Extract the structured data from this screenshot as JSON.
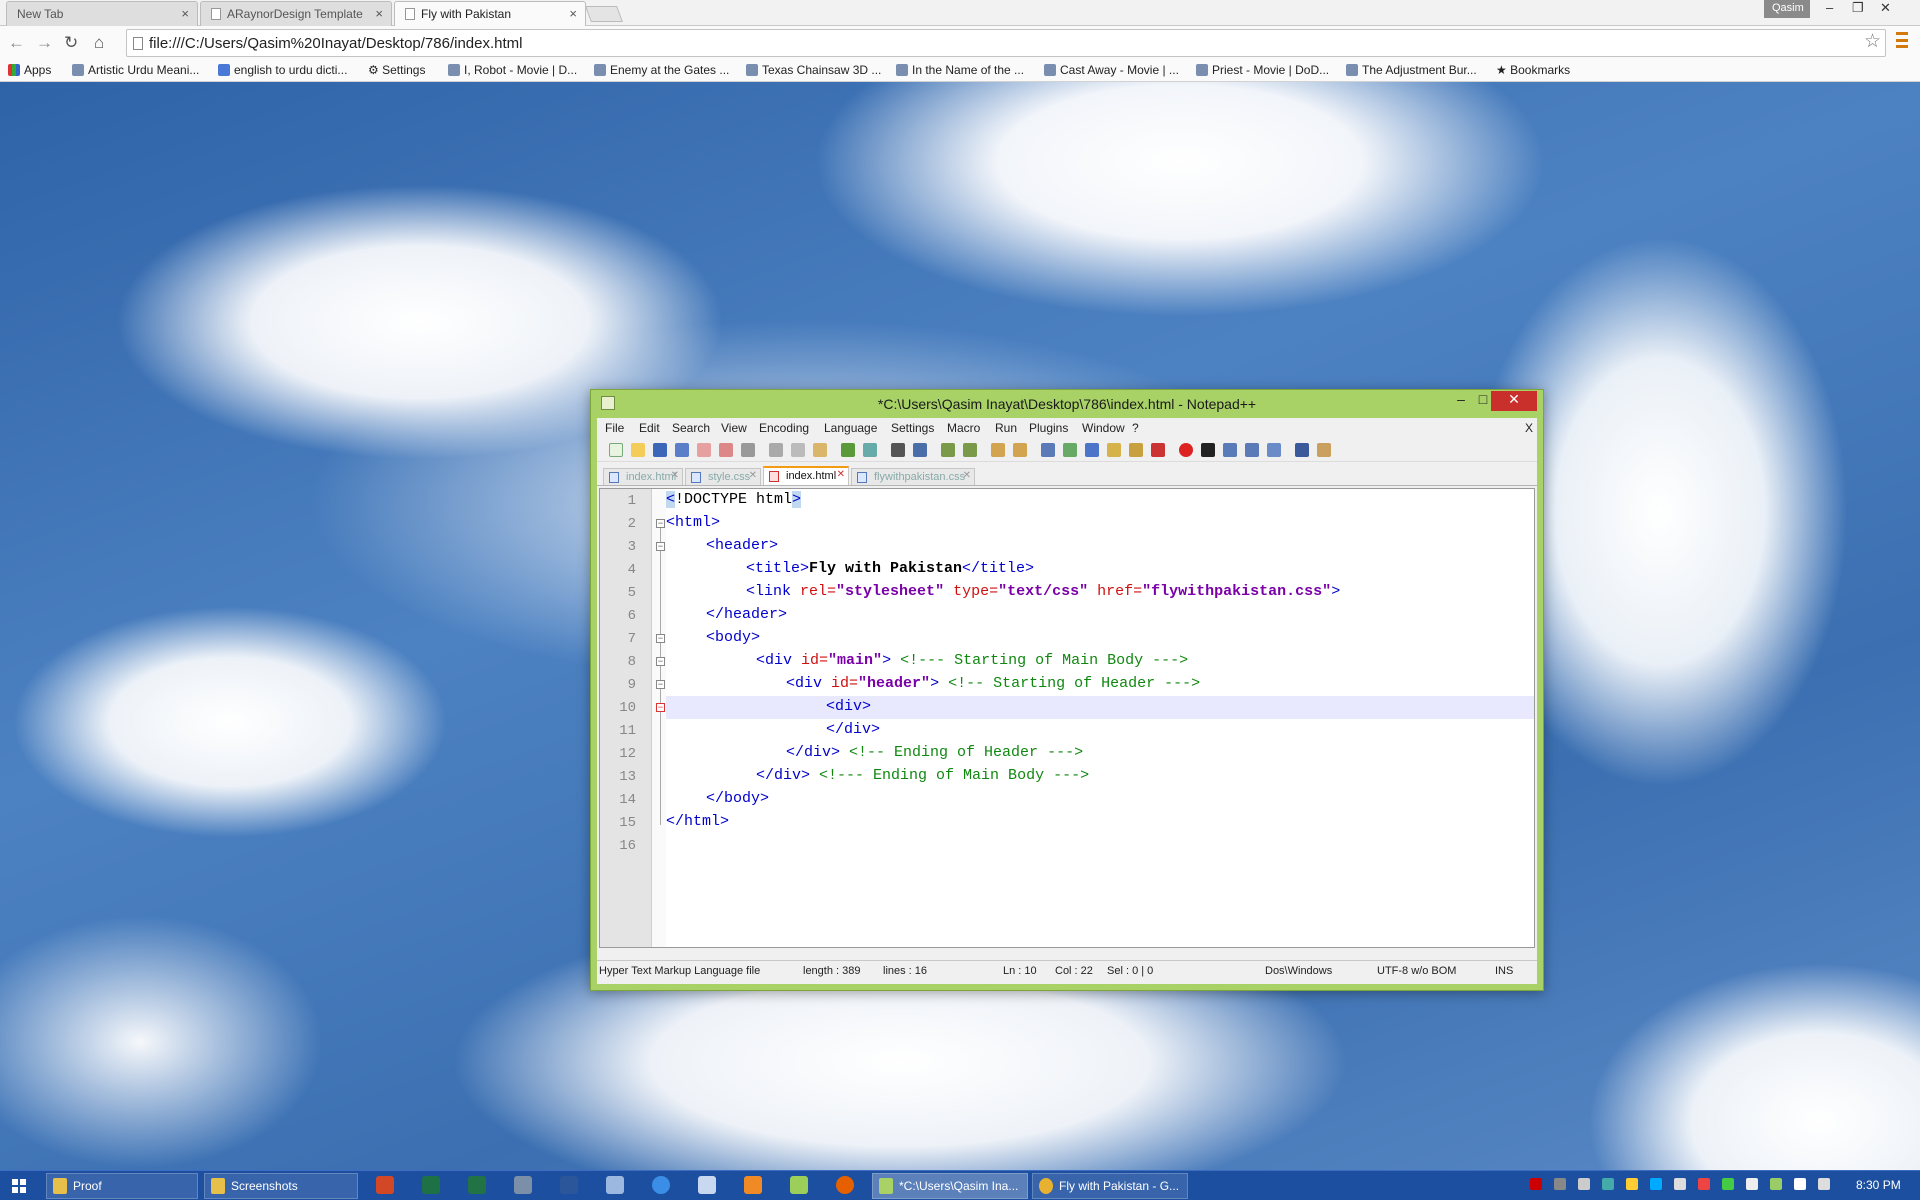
{
  "browser": {
    "tabs": [
      {
        "label": "New Tab"
      },
      {
        "label": "ARaynorDesign Template"
      },
      {
        "label": "Fly with Pakistan"
      }
    ],
    "user": "Qasim",
    "address": "file:///C:/Users/Qasim%20Inayat/Desktop/786/index.html",
    "bookmarks": [
      {
        "label": "Apps"
      },
      {
        "label": "Artistic Urdu Meani..."
      },
      {
        "label": "english to urdu dicti..."
      },
      {
        "label": "Settings"
      },
      {
        "label": "I, Robot - Movie | D..."
      },
      {
        "label": "Enemy at the Gates ..."
      },
      {
        "label": "Texas Chainsaw 3D ..."
      },
      {
        "label": "In the Name of the ..."
      },
      {
        "label": "Cast Away - Movie | ..."
      },
      {
        "label": "Priest - Movie | DoD..."
      },
      {
        "label": "The Adjustment Bur..."
      },
      {
        "label": "Bookmarks"
      }
    ]
  },
  "npp": {
    "title": "*C:\\Users\\Qasim Inayat\\Desktop\\786\\index.html - Notepad++",
    "menu": [
      "File",
      "Edit",
      "Search",
      "View",
      "Encoding",
      "Language",
      "Settings",
      "Macro",
      "Run",
      "Plugins",
      "Window",
      "?"
    ],
    "menu_close": "X",
    "doc_tabs": [
      {
        "label": "index.html"
      },
      {
        "label": "style.css"
      },
      {
        "label": "index.html"
      },
      {
        "label": "flywithpakistan.css"
      }
    ],
    "line_numbers": [
      "1",
      "2",
      "3",
      "4",
      "5",
      "6",
      "7",
      "8",
      "9",
      "10",
      "11",
      "12",
      "13",
      "14",
      "15",
      "16"
    ],
    "code": {
      "l1": {
        "a": "<",
        "b": "!DOCTYPE html",
        "c": ">"
      },
      "l2": "<html>",
      "l3": "<header>",
      "l4": {
        "open": "<title>",
        "text": "Fly with Pakistan",
        "close": "</title>"
      },
      "l5": {
        "tag": "<link",
        "a1": "rel=",
        "v1": "\"stylesheet\"",
        "a2": "type=",
        "v2": "\"text/css\"",
        "a3": "href=",
        "v3": "\"flywithpakistan.css\"",
        "end": ">"
      },
      "l6": "</header>",
      "l7": "<body>",
      "l8": {
        "tag": "<div",
        "attr": "id=",
        "val": "\"main\"",
        "end": ">",
        "comment": "<!--- Starting of Main Body --->"
      },
      "l9": {
        "tag": "<div",
        "attr": "id=",
        "val": "\"header\"",
        "end": ">",
        "comment": "<!-- Starting of Header --->"
      },
      "l10": "<div>",
      "l11": "</div>",
      "l12": {
        "tag": "</div>",
        "comment": "<!-- Ending of Header --->"
      },
      "l13": {
        "tag": "</div>",
        "comment": "<!--- Ending of Main Body --->"
      },
      "l14": "</body>",
      "l15": "</html>"
    },
    "status": {
      "type": "Hyper Text Markup Language file",
      "length": "length : 389",
      "lines": "lines : 16",
      "ln": "Ln : 10",
      "col": "Col : 22",
      "sel": "Sel : 0 | 0",
      "eol": "Dos\\Windows",
      "encoding": "UTF-8 w/o BOM",
      "mode": "INS"
    }
  },
  "taskbar": {
    "items": [
      {
        "label": "Proof"
      },
      {
        "label": "Screenshots"
      },
      {
        "label": "*C:\\Users\\Qasim Ina..."
      },
      {
        "label": "Fly with Pakistan - G..."
      }
    ],
    "clock": "8:30 PM"
  },
  "colors": {
    "npp_frame": "#a8d166",
    "tag": "#0000cc",
    "attr": "#d01010",
    "value": "#7a00a8",
    "comment": "#108810"
  }
}
